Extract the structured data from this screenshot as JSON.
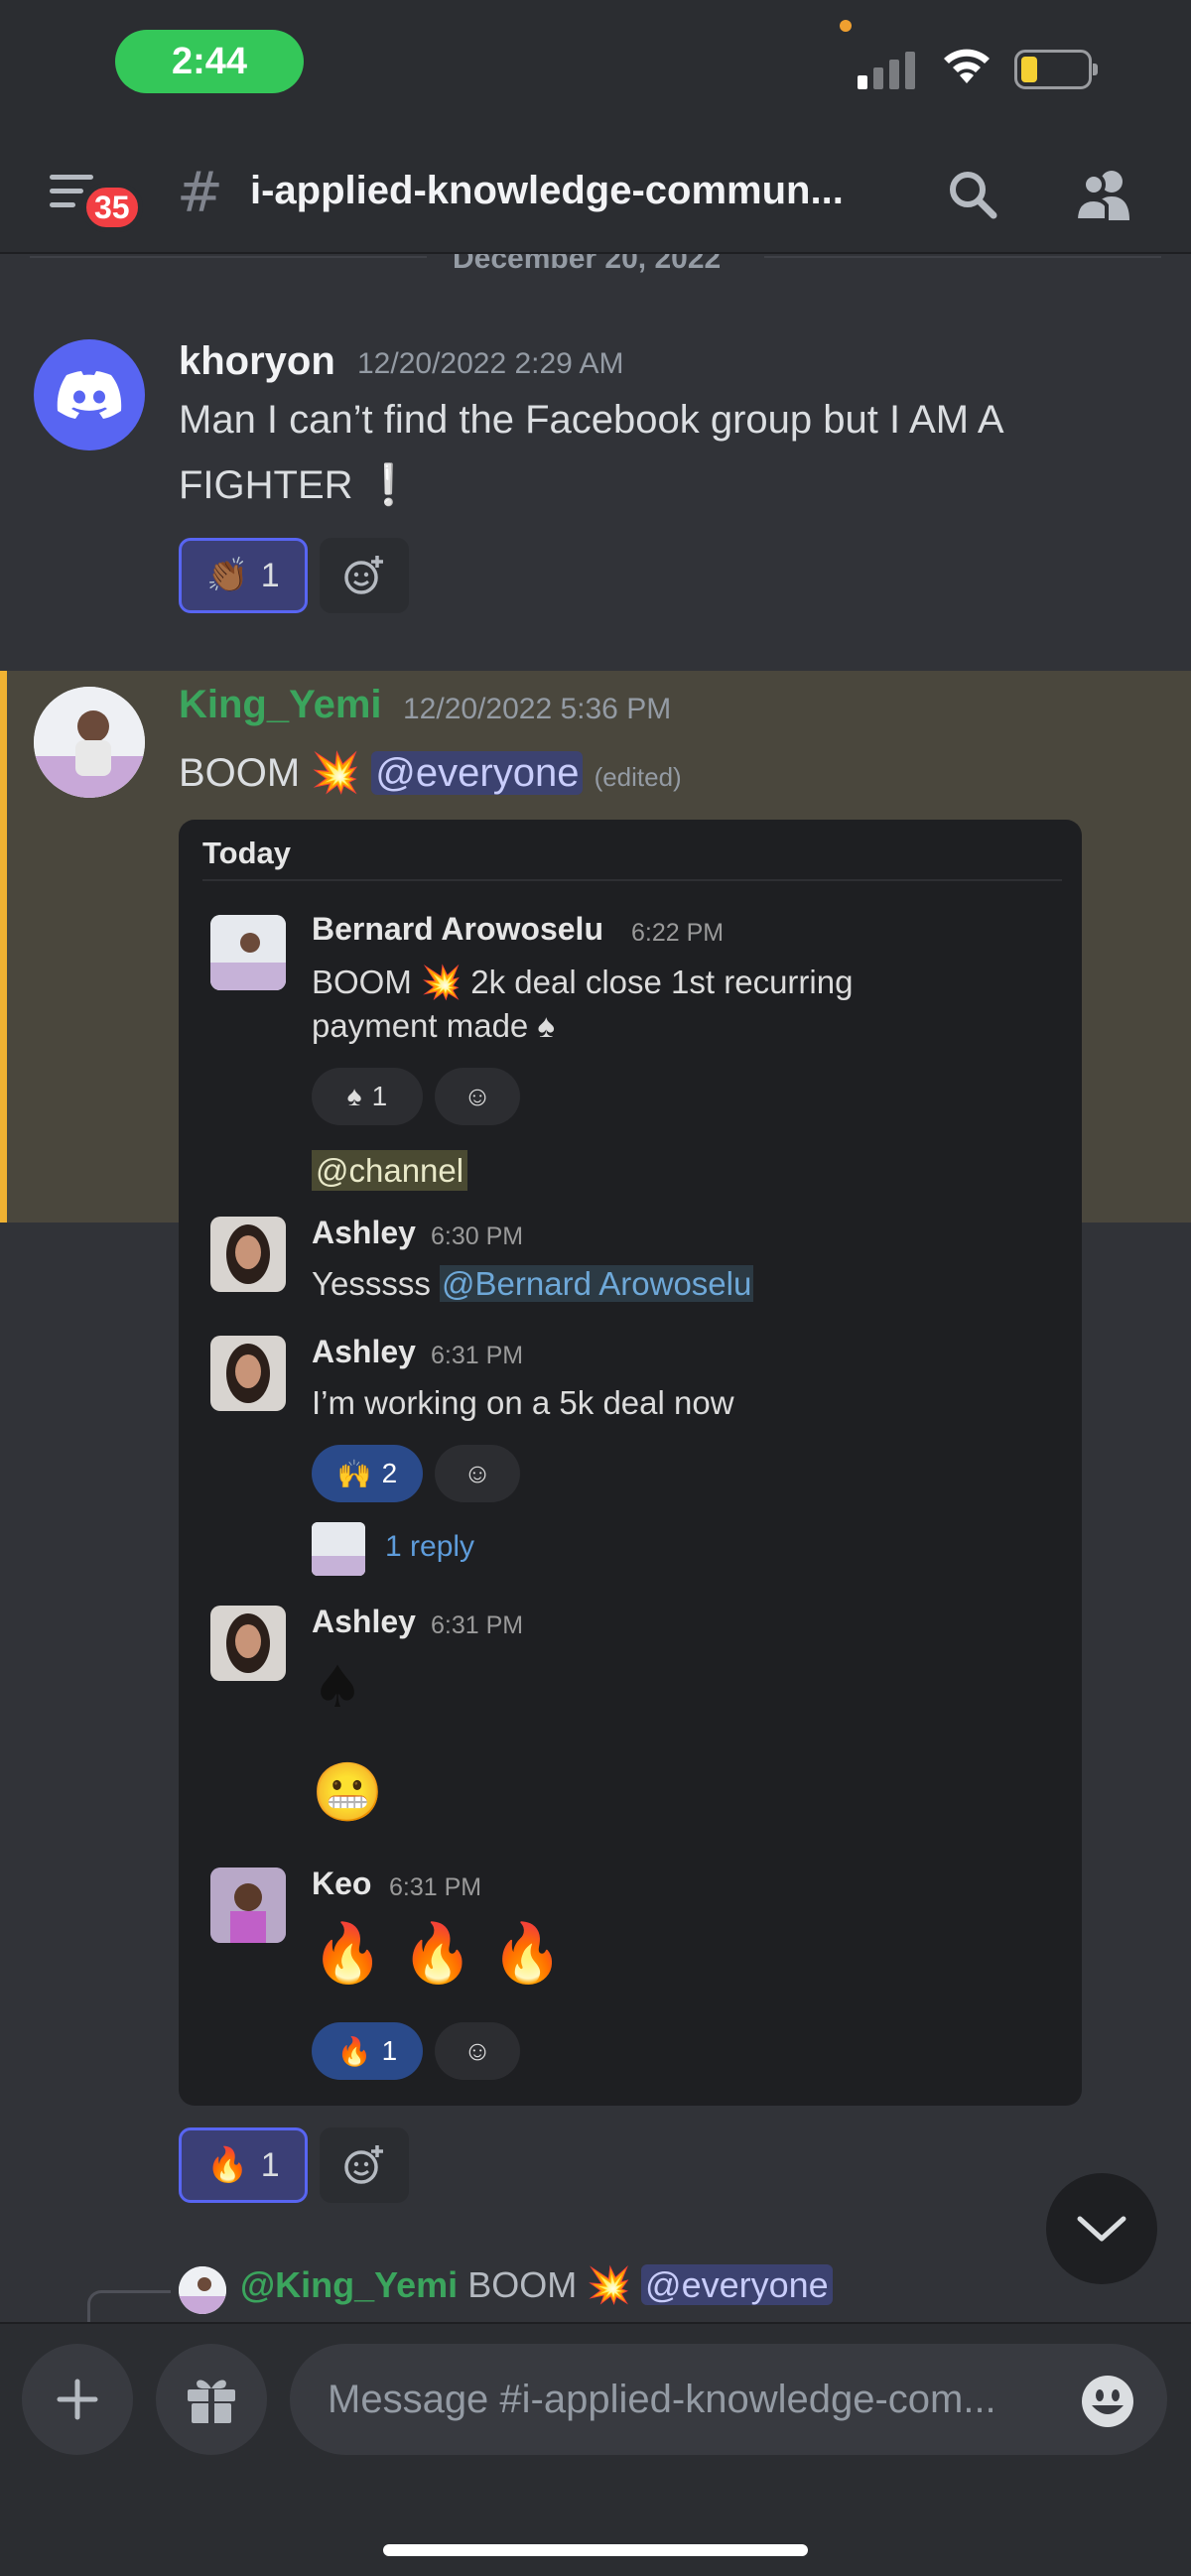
{
  "status_bar": {
    "time": "2:44"
  },
  "header": {
    "badge_count": "35",
    "channel_title": "i-applied-knowledge-commun..."
  },
  "date_divider": "December 20, 2022",
  "messages": [
    {
      "username": "khoryon",
      "timestamp": "12/20/2022 2:29 AM",
      "text_line1": "Man I can’t find the Facebook group but I AM A",
      "text_line2": "FIGHTER ❕",
      "reaction_emoji": "👏🏾",
      "reaction_count": "1"
    },
    {
      "username": "King_Yemi",
      "timestamp": "12/20/2022 5:36 PM",
      "text": "BOOM 💥",
      "mention": "@everyone",
      "edited": "(edited)",
      "reaction_emoji": "🔥",
      "reaction_count": "1"
    }
  ],
  "embed": {
    "header": "Today",
    "messages": [
      {
        "name": "Bernard Arowoselu",
        "time": "6:22 PM",
        "line1": "BOOM 💥 2k deal close 1st recurring",
        "line2": "payment made ♠",
        "reaction_emoji": "♠",
        "reaction_count": "1",
        "channel_mention": "@channel"
      },
      {
        "name": "Ashley",
        "time": "6:30 PM",
        "text": "Yesssss",
        "mention": "@Bernard Arowoselu"
      },
      {
        "name": "Ashley",
        "time": "6:31 PM",
        "text": "I’m working on a 5k deal now",
        "reaction_emoji": "🙌",
        "reaction_count": "2",
        "reply": "1 reply"
      },
      {
        "name": "Ashley",
        "time": "6:31 PM",
        "emoji1": "♠",
        "emoji2": "😬"
      },
      {
        "name": "Keo",
        "time": "6:31 PM",
        "emoji": "🔥 🔥 🔥",
        "reaction_emoji": "🔥",
        "reaction_count": "1"
      }
    ]
  },
  "reply_preview": {
    "username": "@King_Yemi",
    "text": "BOOM 💥",
    "mention": "@everyone"
  },
  "input": {
    "placeholder": "Message #i-applied-knowledge-com..."
  },
  "colors": {
    "accent": "#5865f2",
    "username_green": "#3ba55d",
    "highlight_border": "#f0b232",
    "mention_bg": "#3c4270"
  }
}
